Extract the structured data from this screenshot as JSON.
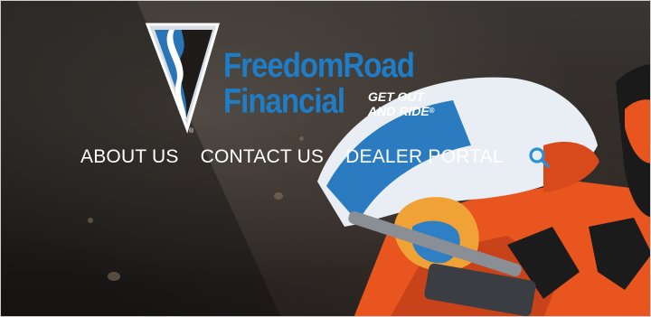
{
  "header": {
    "logo": {
      "brand_line1": "FreedomRoad",
      "brand_line2": "Financial",
      "tagline_line1": "GET OUT",
      "tagline_line2": "AND RIDE",
      "registered_mark": "®"
    },
    "nav": {
      "items": [
        {
          "label": "ABOUT US"
        },
        {
          "label": "CONTACT US"
        },
        {
          "label": "DEALER PORTAL"
        }
      ],
      "search_icon": "search-icon"
    }
  },
  "colors": {
    "brand_blue": "#1e7dc6",
    "nav_text": "#ffffff",
    "search_icon": "#2b8fd9",
    "rider_orange": "#e8551e"
  }
}
